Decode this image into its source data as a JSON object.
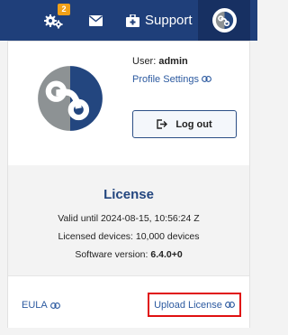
{
  "topbar": {
    "notification_count": "2",
    "support_label": "Support",
    "icons": [
      "gears-icon",
      "envelope-icon",
      "support-briefcase-icon",
      "app-logo-icon"
    ]
  },
  "user": {
    "user_prefix": "User: ",
    "username": "admin",
    "profile_link": "Profile Settings",
    "logout_label": "Log out"
  },
  "license": {
    "title": "License",
    "valid_until": "Valid until 2024-08-15, 10:56:24 Z",
    "devices": "Licensed devices: 10,000 devices",
    "version_prefix": "Software version: ",
    "version": "6.4.0+0"
  },
  "footer": {
    "eula_label": "EULA",
    "upload_label": "Upload License"
  },
  "colors": {
    "navbar": "#1f3f7a",
    "accent": "#2c5aa0",
    "badge": "#f0a018",
    "highlight": "#e01010"
  }
}
